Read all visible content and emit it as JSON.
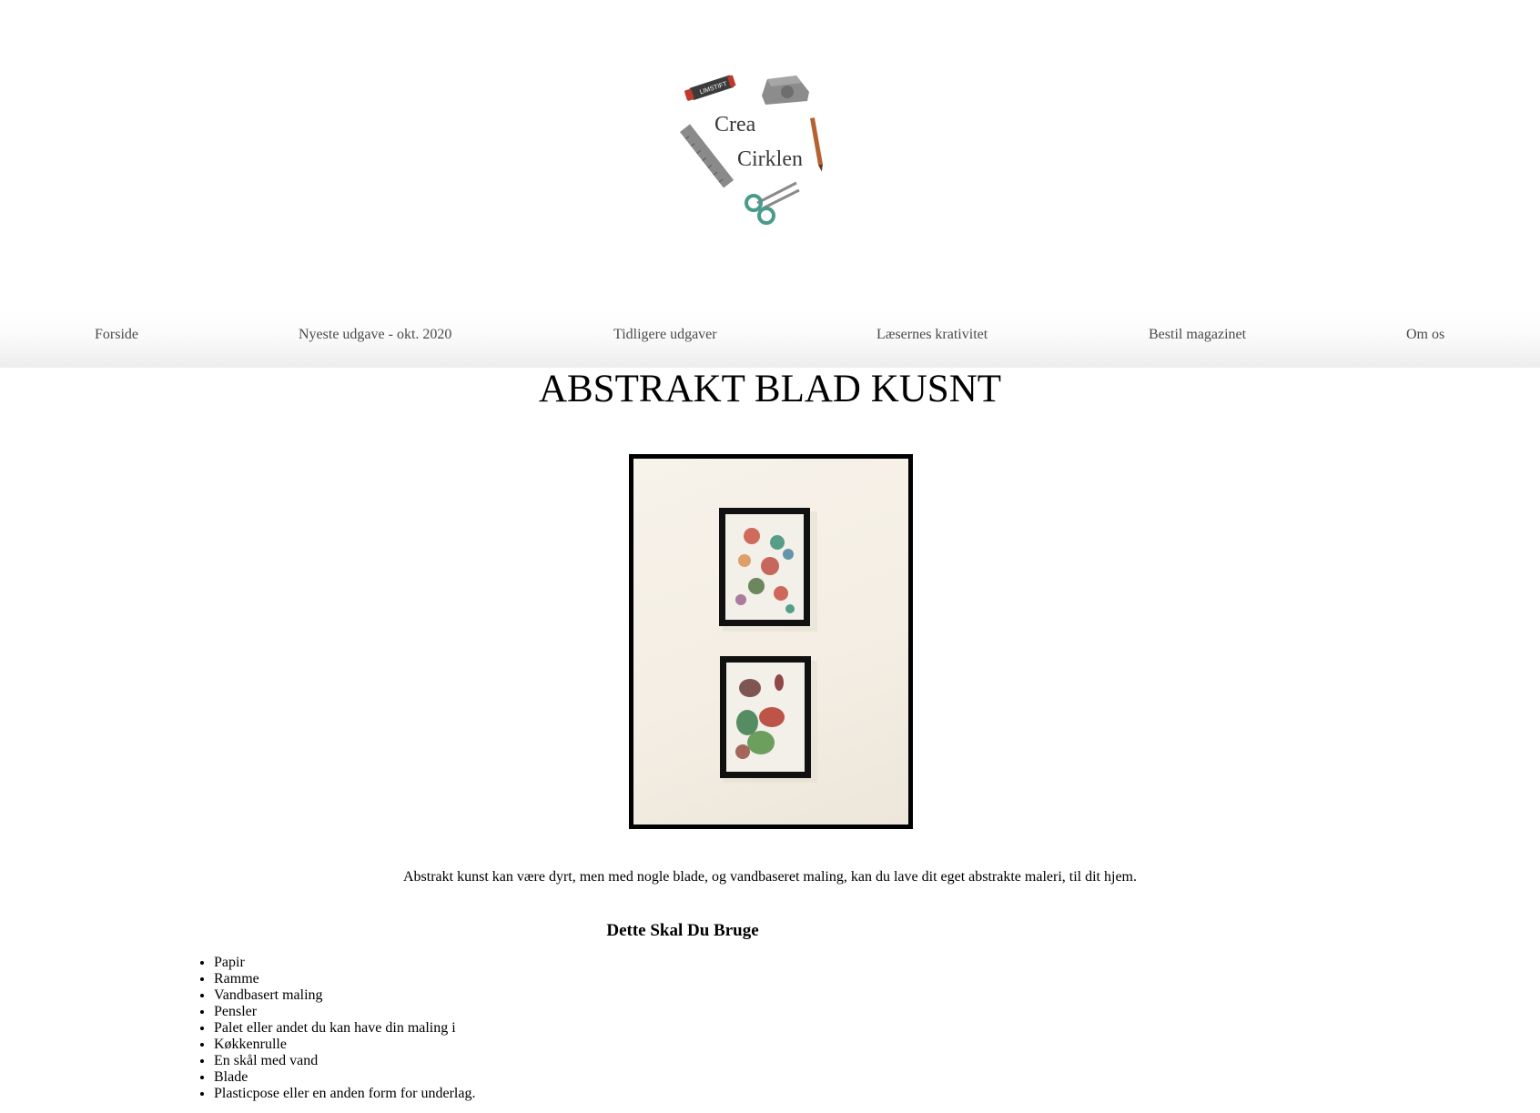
{
  "logo": {
    "line1": "Crea",
    "line2": "Cirklen",
    "tape_label": "LIMSTIFT",
    "colors": {
      "scissors": "#4b9a8a",
      "pencil": "#b4622f",
      "glue": "#c0392b",
      "ruler": "#8a8a8a"
    }
  },
  "nav": {
    "items": [
      {
        "label": "Forside"
      },
      {
        "label": "Nyeste udgave - okt. 2020"
      },
      {
        "label": "Tidligere udgaver"
      },
      {
        "label": "Læsernes krativitet"
      },
      {
        "label": "Bestil magazinet"
      },
      {
        "label": "Om os"
      }
    ]
  },
  "article": {
    "title": "ABSTRAKT BLAD KUSNT",
    "intro": "Abstrakt kunst kan være dyrt, men med nogle blade, og vandbaseret maling, kan du lave dit eget abstrakte maleri, til dit hjem.",
    "materials_heading": "Dette Skal Du Bruge",
    "materials": [
      "Papir",
      "Ramme",
      "Vandbasert maling",
      "Pensler",
      "Palet eller andet du kan have din maling i",
      "Køkkenrulle",
      "En skål med vand",
      "Blade",
      "Plasticpose eller en anden form for underlag."
    ]
  }
}
